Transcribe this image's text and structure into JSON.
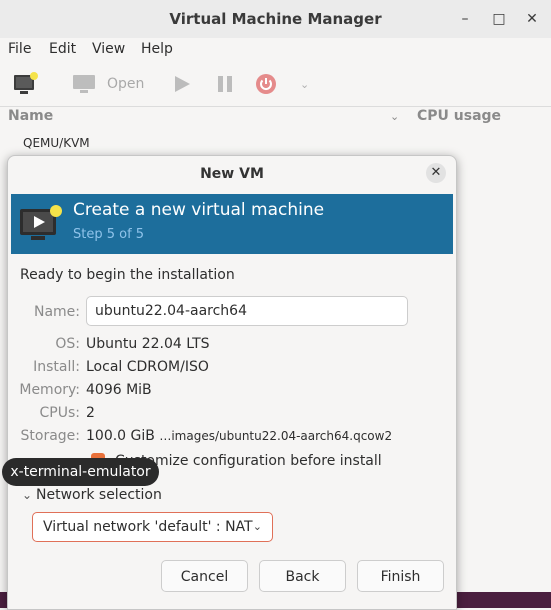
{
  "window": {
    "title": "Virtual Machine Manager"
  },
  "menu": [
    "File",
    "Edit",
    "View",
    "Help"
  ],
  "toolbar": {
    "open_label": "Open"
  },
  "list": {
    "col_name": "Name",
    "col_cpu": "CPU usage",
    "connection": "QEMU/KVM"
  },
  "dialog": {
    "title": "New VM",
    "banner_title": "Create a new virtual machine",
    "banner_step": "Step 5 of 5",
    "ready_text": "Ready to begin the installation",
    "name_label": "Name:",
    "name_value": "ubuntu22.04-aarch64",
    "os_label": "OS:",
    "os_value": "Ubuntu 22.04 LTS",
    "install_label": "Install:",
    "install_value": "Local CDROM/ISO",
    "memory_label": "Memory:",
    "memory_value": "4096 MiB",
    "cpus_label": "CPUs:",
    "cpus_value": "2",
    "storage_label": "Storage:",
    "storage_size": "100.0 GiB",
    "storage_path": "…images/ubuntu22.04-aarch64.qcow2",
    "customize_label": "Customize configuration before install",
    "network_section": "Network selection",
    "network_value": "Virtual network 'default' : NAT",
    "cancel_label": "Cancel",
    "back_label": "Back",
    "finish_label": "Finish"
  },
  "tooltip": "x-terminal-emulator",
  "colors": {
    "banner": "#1d6e9c",
    "accent": "#e9713a",
    "step_text": "#8fc3ea"
  }
}
